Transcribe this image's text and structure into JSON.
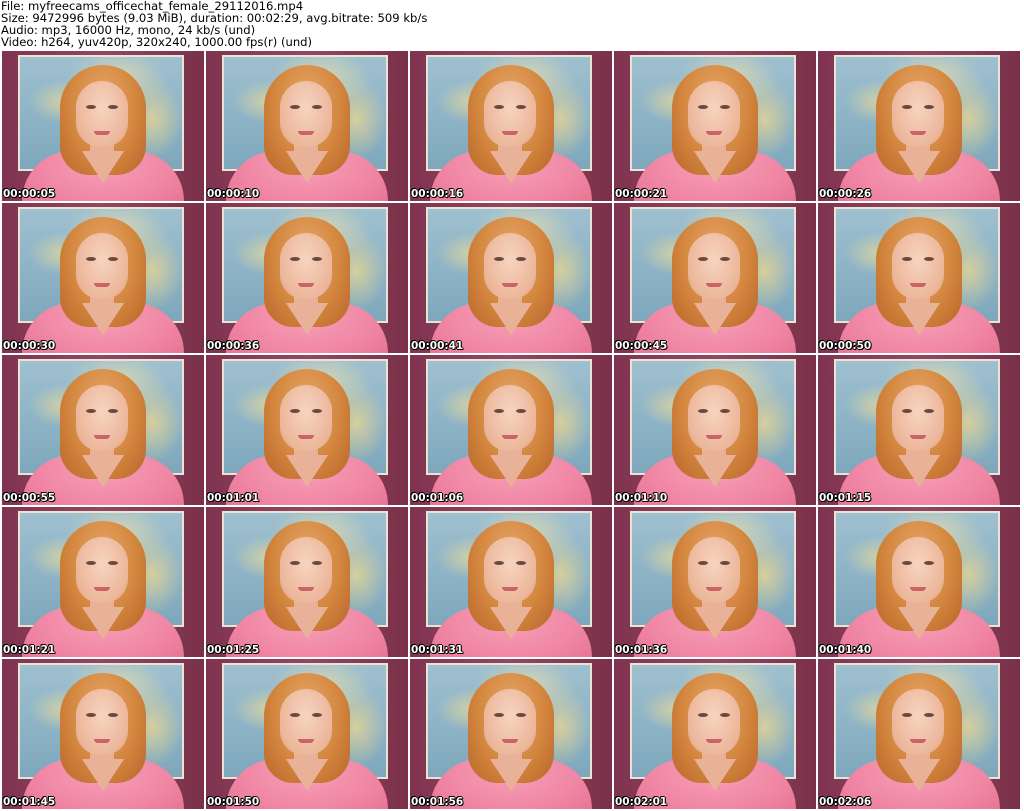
{
  "header": {
    "file": "File: myfreecams_officechat_female_29112016.mp4",
    "size": "Size: 9472996 bytes (9.03 MiB), duration: 00:02:29, avg.bitrate: 509 kb/s",
    "audio": "Audio: mp3, 16000 Hz, mono, 24 kb/s (und)",
    "video": "Video: h264, yuv420p, 320x240, 1000.00 fps(r) (und)"
  },
  "thumbnails": [
    {
      "time": "00:00:05"
    },
    {
      "time": "00:00:10"
    },
    {
      "time": "00:00:16"
    },
    {
      "time": "00:00:21"
    },
    {
      "time": "00:00:26"
    },
    {
      "time": "00:00:30"
    },
    {
      "time": "00:00:36"
    },
    {
      "time": "00:00:41"
    },
    {
      "time": "00:00:45"
    },
    {
      "time": "00:00:50"
    },
    {
      "time": "00:00:55"
    },
    {
      "time": "00:01:01"
    },
    {
      "time": "00:01:06"
    },
    {
      "time": "00:01:10"
    },
    {
      "time": "00:01:15"
    },
    {
      "time": "00:01:21"
    },
    {
      "time": "00:01:25"
    },
    {
      "time": "00:01:31"
    },
    {
      "time": "00:01:36"
    },
    {
      "time": "00:01:40"
    },
    {
      "time": "00:01:45"
    },
    {
      "time": "00:01:50"
    },
    {
      "time": "00:01:56"
    },
    {
      "time": "00:02:01"
    },
    {
      "time": "00:02:06"
    }
  ]
}
